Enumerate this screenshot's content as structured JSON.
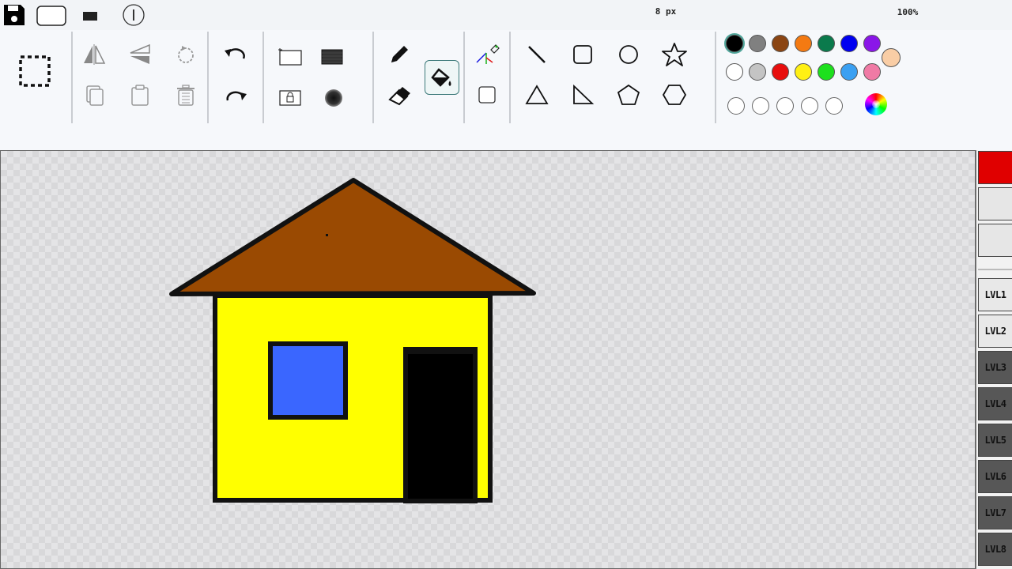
{
  "topbar": {
    "icons": [
      "save-icon",
      "rounded-rect-icon",
      "filled-rect-icon",
      "info-icon"
    ],
    "brush_size": "8 px",
    "zoom": "100%"
  },
  "toolbar": {
    "groups": [
      {
        "name": "selection",
        "tools": [
          "select-rect-icon"
        ]
      },
      {
        "name": "transform",
        "tools": [
          "flip-horizontal-icon",
          "flip-vertical-icon",
          "rotate-icon",
          "copy-icon",
          "paste-icon",
          "delete-icon"
        ]
      },
      {
        "name": "history",
        "tools": [
          "undo-icon",
          "redo-icon"
        ]
      },
      {
        "name": "image",
        "tools": [
          "crop-frame-icon",
          "fill-texture-icon",
          "lock-frame-icon",
          "blur-circle-icon"
        ]
      },
      {
        "name": "draw",
        "tools": [
          "pencil-icon",
          "fill-bucket-icon",
          "eraser-icon"
        ],
        "active": "fill-bucket-icon"
      },
      {
        "name": "misc",
        "tools": [
          "color-picker-icon",
          "square-outline-icon"
        ]
      },
      {
        "name": "shapes",
        "tools": [
          "line-icon",
          "rounded-square-icon",
          "circle-icon",
          "star-icon",
          "triangle-icon",
          "right-triangle-icon",
          "pentagon-icon",
          "hexagon-icon"
        ]
      }
    ]
  },
  "palette": {
    "row1": [
      "#000000",
      "#808080",
      "#8B4513",
      "#F47A12",
      "#0B7A4C",
      "#0000F0",
      "#8A16E8"
    ],
    "row2": [
      "#FFFFFF",
      "#C4C4C4",
      "#E80E0E",
      "#FFF014",
      "#1DE01D",
      "#3AA0F2",
      "#F07AA5"
    ],
    "row3": [
      "empty",
      "empty",
      "empty",
      "empty",
      "empty"
    ],
    "extra": "#F9CDA5",
    "selected": "#000000",
    "color_wheel": "color-wheel-icon"
  },
  "drawing": {
    "roof_color": "#9A4A02",
    "wall_color": "#FFFF00",
    "window_color": "#3A66FF",
    "door_color": "#000000",
    "outline_color": "#111111"
  },
  "layers": {
    "items": [
      {
        "label": "",
        "style": "red"
      },
      {
        "label": "",
        "style": "blank"
      },
      {
        "label": "",
        "style": "blank"
      },
      {
        "label": "LVL1",
        "style": "light"
      },
      {
        "label": "LVL2",
        "style": "light"
      },
      {
        "label": "LVL3",
        "style": "dark"
      },
      {
        "label": "LVL4",
        "style": "dark"
      },
      {
        "label": "LVL5",
        "style": "dark"
      },
      {
        "label": "LVL6",
        "style": "dark"
      },
      {
        "label": "LVL7",
        "style": "dark"
      },
      {
        "label": "LVL8",
        "style": "dark"
      }
    ]
  }
}
